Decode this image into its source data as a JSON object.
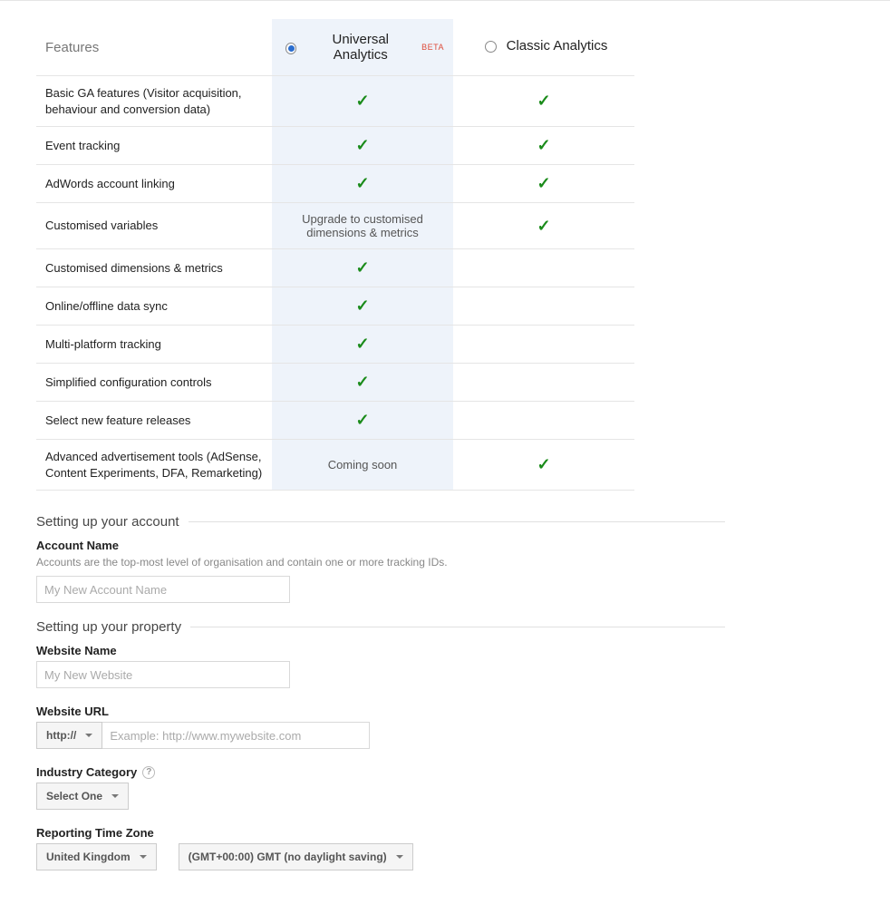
{
  "table": {
    "features_head": "Features",
    "col_ua_label": "Universal Analytics",
    "col_ua_beta": "BETA",
    "col_classic_label": "Classic Analytics",
    "rows": [
      {
        "feature": "Basic GA features (Visitor acquisition, behaviour and conversion data)",
        "ua": "check",
        "classic": "check"
      },
      {
        "feature": "Event tracking",
        "ua": "check",
        "classic": "check"
      },
      {
        "feature": "AdWords account linking",
        "ua": "check",
        "classic": "check"
      },
      {
        "feature": "Customised variables",
        "ua": "Upgrade to customised dimensions & metrics",
        "classic": "check"
      },
      {
        "feature": "Customised dimensions & metrics",
        "ua": "check",
        "classic": ""
      },
      {
        "feature": "Online/offline data sync",
        "ua": "check",
        "classic": ""
      },
      {
        "feature": "Multi-platform tracking",
        "ua": "check",
        "classic": ""
      },
      {
        "feature": "Simplified configuration controls",
        "ua": "check",
        "classic": ""
      },
      {
        "feature": "Select new feature releases",
        "ua": "check",
        "classic": ""
      },
      {
        "feature": "Advanced advertisement tools (AdSense, Content Experiments, DFA, Remarketing)",
        "ua": "Coming soon",
        "classic": "check"
      }
    ]
  },
  "sections": {
    "account_head": "Setting up your account",
    "property_head": "Setting up your property"
  },
  "account": {
    "name_label": "Account Name",
    "name_desc": "Accounts are the top-most level of organisation and contain one or more tracking IDs.",
    "name_placeholder": "My New Account Name"
  },
  "property": {
    "website_name_label": "Website Name",
    "website_name_placeholder": "My New Website",
    "website_url_label": "Website URL",
    "protocol_selected": "http://",
    "url_placeholder": "Example: http://www.mywebsite.com",
    "industry_label": "Industry Category",
    "industry_selected": "Select One",
    "timezone_label": "Reporting Time Zone",
    "country_selected": "United Kingdom",
    "tz_selected": "(GMT+00:00) GMT (no daylight saving)"
  }
}
